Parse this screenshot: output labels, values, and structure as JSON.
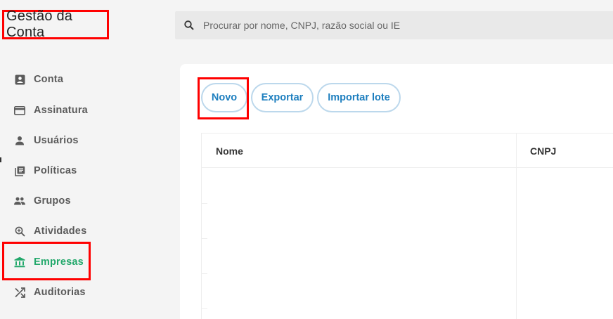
{
  "app_title": "Gestão da Conta",
  "search": {
    "placeholder": "Procurar por nome, CNPJ, razão social ou IE"
  },
  "sidebar": {
    "items": [
      {
        "label": "Conta",
        "icon": "account-box-icon"
      },
      {
        "label": "Assinatura",
        "icon": "credit-card-icon"
      },
      {
        "label": "Usuários",
        "icon": "person-icon"
      },
      {
        "label": "Políticas",
        "icon": "library-books-icon"
      },
      {
        "label": "Grupos",
        "icon": "people-icon"
      },
      {
        "label": "Atividades",
        "icon": "zoom-in-icon"
      },
      {
        "label": "Empresas",
        "icon": "bank-icon",
        "active": true
      },
      {
        "label": "Auditorias",
        "icon": "shuffle-icon"
      }
    ]
  },
  "toolbar": {
    "new_label": "Novo",
    "export_label": "Exportar",
    "import_label": "Importar lote"
  },
  "table": {
    "columns": [
      "Nome",
      "CNPJ"
    ]
  },
  "colors": {
    "accent_active": "#23a86b",
    "button_text": "#1e7fbf",
    "highlight": "#ff0000"
  }
}
